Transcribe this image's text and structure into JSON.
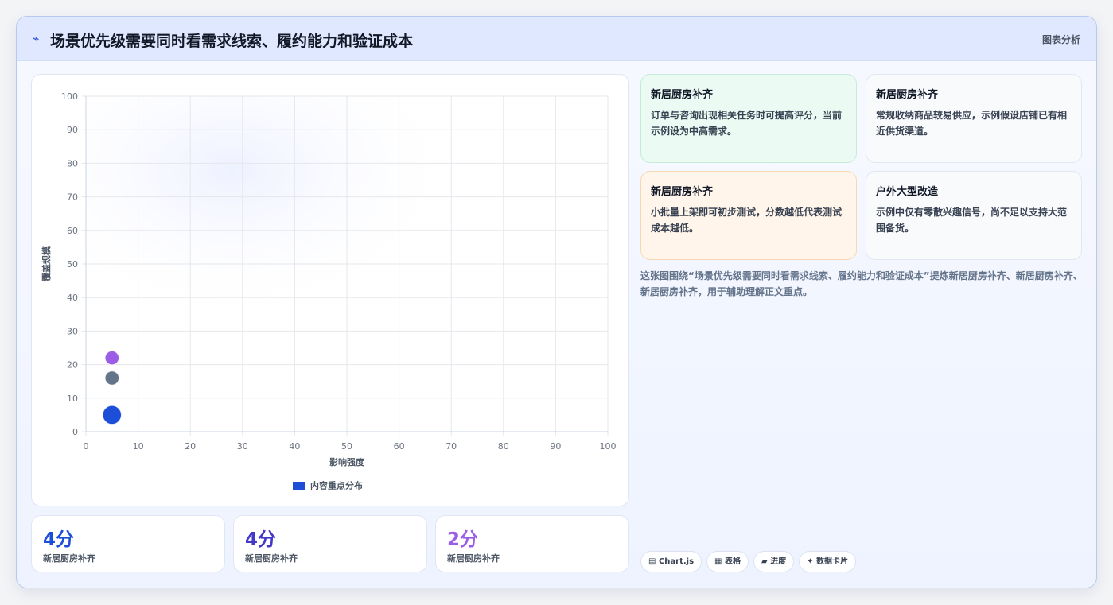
{
  "header": {
    "icon": "lightning-icon",
    "title": "场景优先级需要同时看需求线索、履约能力和验证成本",
    "tag": "图表分析"
  },
  "chart_data": {
    "type": "scatter",
    "xlabel": "影响强度",
    "ylabel": "覆盖规模",
    "xlim": [
      0,
      100
    ],
    "ylim": [
      0,
      100
    ],
    "x_ticks": [
      "0",
      "10",
      "20",
      "30",
      "40",
      "50",
      "60",
      "70",
      "80",
      "90",
      "100"
    ],
    "y_ticks": [
      "0",
      "10",
      "20",
      "30",
      "40",
      "50",
      "60",
      "70",
      "80",
      "90",
      "100"
    ],
    "grid": true,
    "legend": "bottom",
    "series": [
      {
        "name": "内容重点分布",
        "points": [
          {
            "x": 5,
            "y": 22,
            "r": 9,
            "color": "#9b5de5"
          },
          {
            "x": 5,
            "y": 16,
            "r": 9,
            "color": "#64748b"
          },
          {
            "x": 5,
            "y": 5,
            "r": 12,
            "color": "#1d4ed8"
          }
        ]
      }
    ]
  },
  "stats": [
    {
      "value": "4分",
      "label": "新居厨房补齐",
      "color": "#1d4ed8"
    },
    {
      "value": "4分",
      "label": "新居厨房补齐",
      "color": "#4338ca"
    },
    {
      "value": "2分",
      "label": "新居厨房补齐",
      "color": "#9b5de5"
    }
  ],
  "cards": [
    {
      "title": "新居厨房补齐",
      "body": "订单与咨询出现相关任务时可提高评分，当前示例设为中高需求。"
    },
    {
      "title": "新居厨房补齐",
      "body": "常规收纳商品较易供应，示例假设店铺已有相近供货渠道。"
    },
    {
      "title": "新居厨房补齐",
      "body": "小批量上架即可初步测试，分数越低代表测试成本越低。"
    },
    {
      "title": "户外大型改造",
      "body": "示例中仅有零散兴趣信号，尚不足以支持大范围备货。"
    }
  ],
  "summary": "这张图围绕“场景优先级需要同时看需求线索、履约能力和验证成本”提炼新居厨房补齐、新居厨房补齐、新居厨房补齐，用于辅助理解正文重点。",
  "chips": [
    {
      "icon": "chart-icon",
      "label": "Chart.js"
    },
    {
      "icon": "table-icon",
      "label": "表格"
    },
    {
      "icon": "progress-icon",
      "label": "进度"
    },
    {
      "icon": "sparkle-icon",
      "label": "数据卡片"
    }
  ]
}
